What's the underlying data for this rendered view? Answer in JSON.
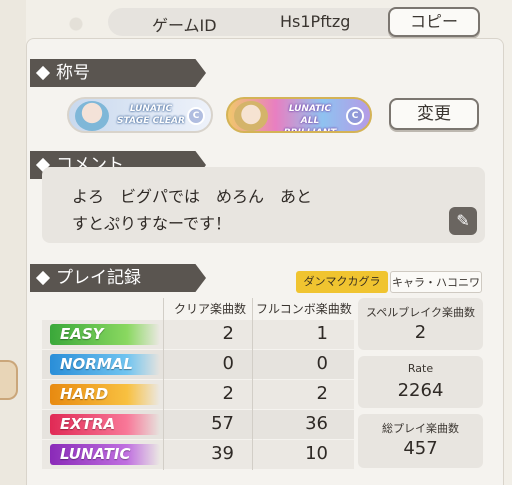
{
  "header": {
    "game_id_label": "ゲームID",
    "game_id_value": "Hs1Pftzg",
    "copy_button": "コピー"
  },
  "titles_section": {
    "heading": "称号",
    "badges": [
      {
        "line1": "LUNATIC",
        "line2": "STAGE CLEAR",
        "icon": "medal-icon"
      },
      {
        "line1": "LUNATIC",
        "line2": "ALL BRILLIANT",
        "icon": "medal-icon"
      }
    ],
    "change_button": "変更"
  },
  "comment_section": {
    "heading": "コメント",
    "line1": "よろ　ビグパでは　めろん　あと",
    "line2": "すとぷりすなーです！",
    "edit_icon": "pencil-icon"
  },
  "play_record": {
    "heading": "プレイ記録",
    "tabs": [
      "ダンマクカグラ",
      "キャラ・ハコニワ"
    ],
    "active_tab": 0,
    "columns": [
      "クリア楽曲数",
      "フルコンボ楽曲数"
    ],
    "rows": [
      {
        "difficulty": "EASY",
        "color": "#57c04a",
        "clear": "2",
        "fullcombo": "1"
      },
      {
        "difficulty": "NORMAL",
        "color": "#4aa6e0",
        "clear": "0",
        "fullcombo": "0"
      },
      {
        "difficulty": "HARD",
        "color": "#f0a020",
        "clear": "2",
        "fullcombo": "2"
      },
      {
        "difficulty": "EXTRA",
        "color": "#e8406a",
        "clear": "57",
        "fullcombo": "36"
      },
      {
        "difficulty": "LUNATIC",
        "color": "#a040c8",
        "clear": "39",
        "fullcombo": "10"
      }
    ],
    "stats": [
      {
        "label": "スペルブレイク楽曲数",
        "value": "2"
      },
      {
        "label": "Rate",
        "value": "2264"
      },
      {
        "label": "総プレイ楽曲数",
        "value": "457"
      }
    ]
  }
}
